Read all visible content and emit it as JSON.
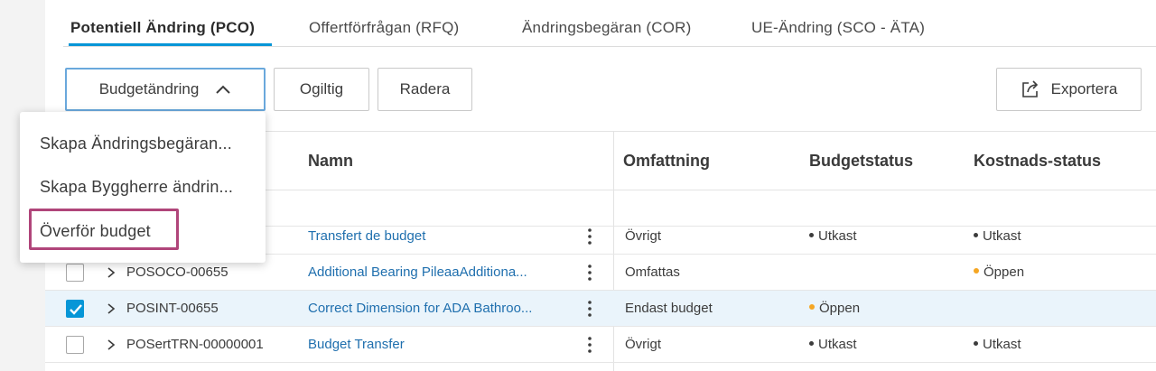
{
  "tabs": [
    {
      "label": "Potentiell Ändring (PCO)",
      "active": true
    },
    {
      "label": "Offertförfrågan (RFQ)",
      "active": false
    },
    {
      "label": "Ändringsbegäran (COR)",
      "active": false
    },
    {
      "label": "UE-Ändring (SCO - ÄTA)",
      "active": false
    }
  ],
  "toolbar": {
    "budget_change_label": "Budgetändring",
    "invalid_label": "Ogiltig",
    "delete_label": "Radera",
    "export_label": "Exportera"
  },
  "dropdown": {
    "items": [
      "Skapa Ändringsbegäran...",
      "Skapa Byggherre ändrin...",
      "Överför budget"
    ],
    "highlighted_index": 2
  },
  "table": {
    "columns": [
      "Namn",
      "Omfattning",
      "Budgetstatus",
      "Kostnads-status"
    ],
    "rows": [
      {
        "checked": false,
        "id": "",
        "name": "Transfert de budget",
        "scope": "Övrigt",
        "budget_status": "Utkast",
        "budget_dot": "#3c3c3c",
        "cost_status": "Utkast",
        "cost_dot": "#3c3c3c"
      },
      {
        "checked": false,
        "id": "POSOCO-00655",
        "name": "Additional Bearing PileaaAdditiona...",
        "scope": "Omfattas",
        "budget_status": "",
        "budget_dot": "",
        "cost_status": "Öppen",
        "cost_dot": "#f5a623"
      },
      {
        "checked": true,
        "id": "POSINT-00655",
        "name": "Correct Dimension for ADA Bathroo...",
        "scope": "Endast budget",
        "budget_status": "Öppen",
        "budget_dot": "#f5a623",
        "cost_status": "",
        "cost_dot": ""
      },
      {
        "checked": false,
        "id": "POSertTRN-00000001",
        "name": "Budget Transfer",
        "scope": "Övrigt",
        "budget_status": "Utkast",
        "budget_dot": "#3c3c3c",
        "cost_status": "Utkast",
        "cost_dot": "#3c3c3c"
      }
    ]
  },
  "colors": {
    "accent": "#0696d7",
    "link": "#1f6fae",
    "highlight_border": "#b0457a",
    "open_status": "#f5a623"
  }
}
